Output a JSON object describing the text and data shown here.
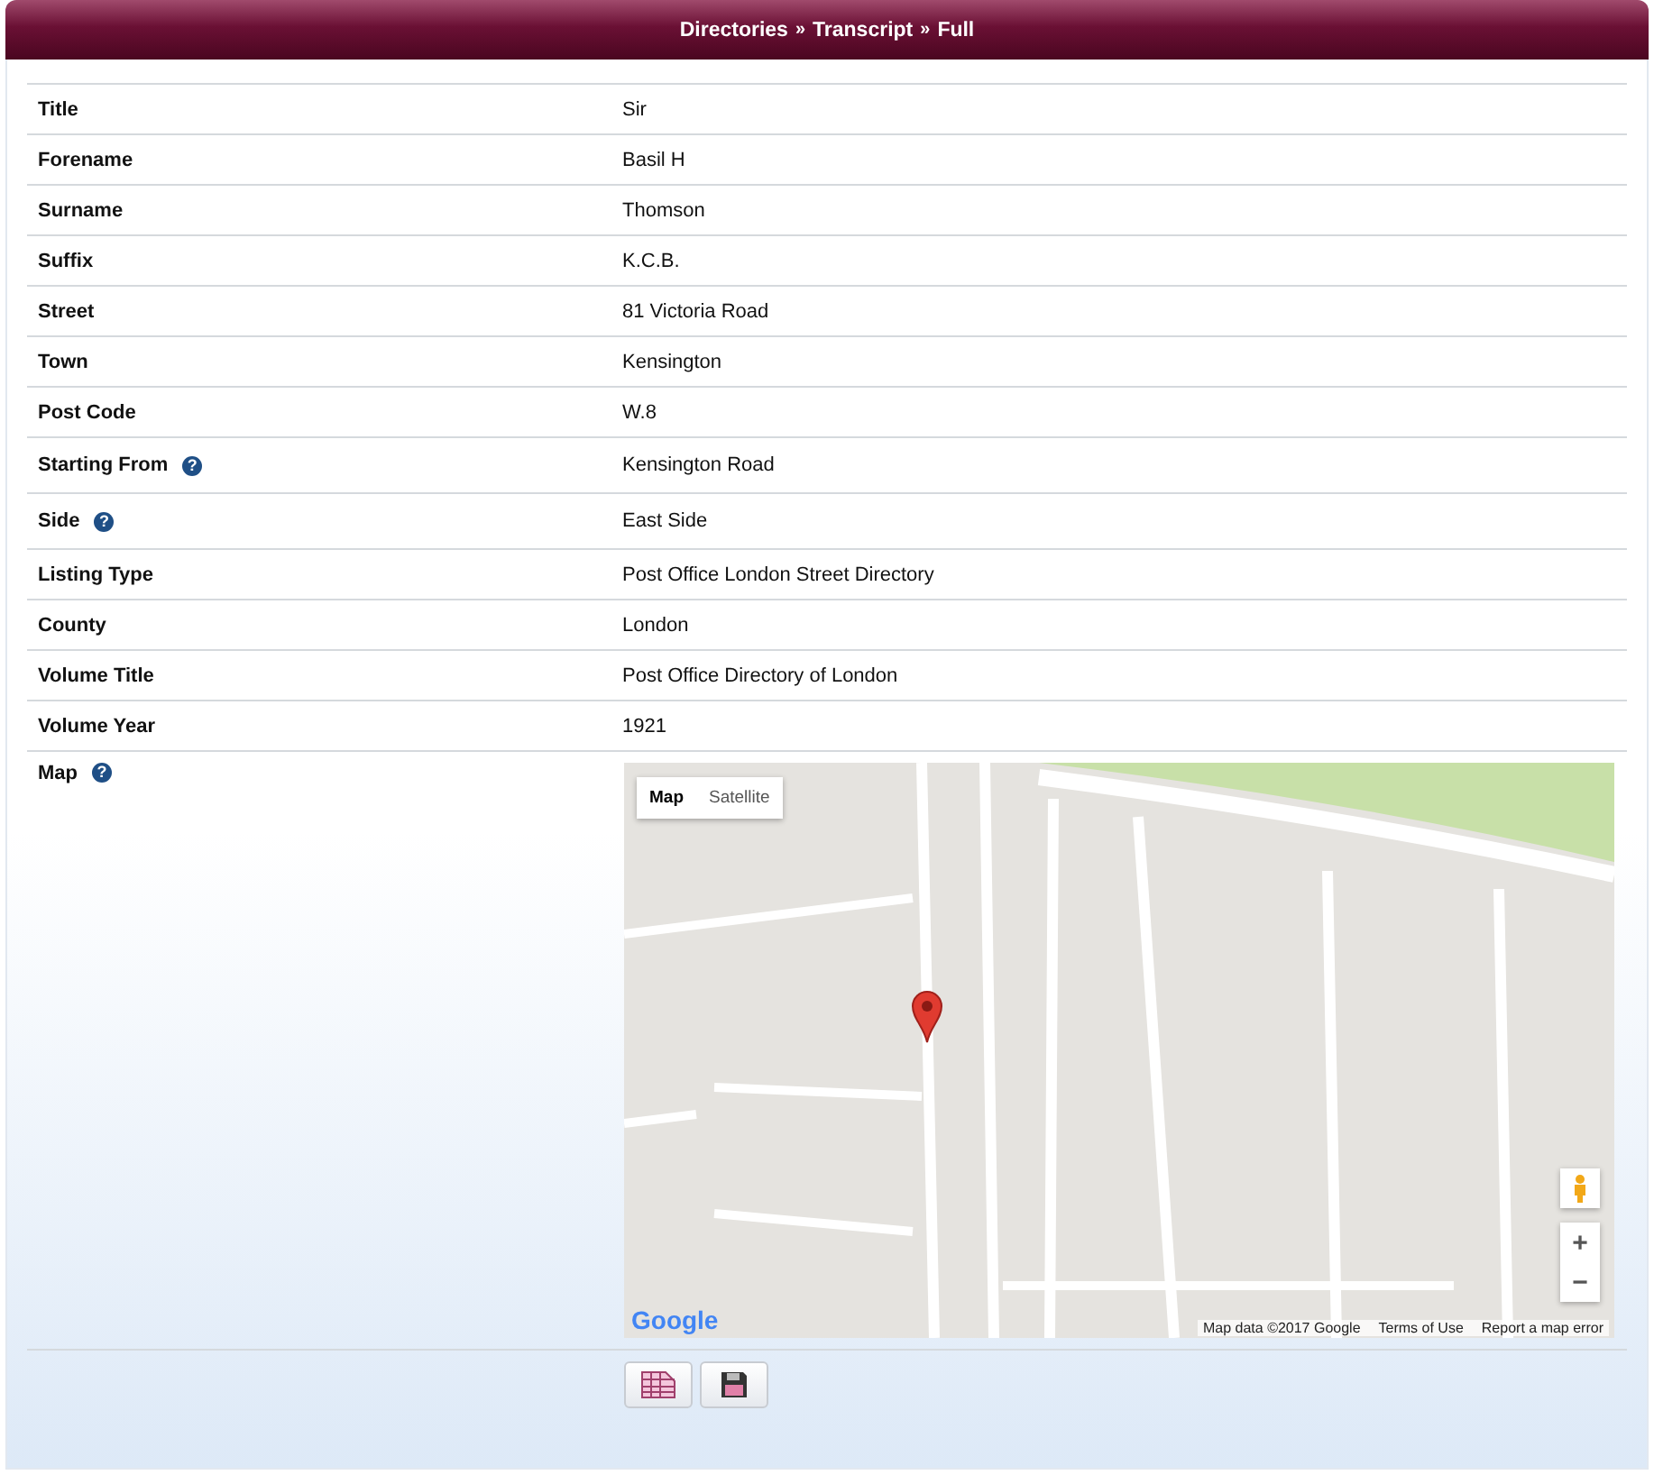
{
  "header": {
    "breadcrumb": [
      "Directories",
      "Transcript",
      "Full"
    ],
    "separator": "»"
  },
  "fields": [
    {
      "label": "Title",
      "value": "Sir"
    },
    {
      "label": "Forename",
      "value": "Basil H"
    },
    {
      "label": "Surname",
      "value": "Thomson"
    },
    {
      "label": "Suffix",
      "value": "K.C.B."
    },
    {
      "label": "Street",
      "value": "81 Victoria Road"
    },
    {
      "label": "Town",
      "value": "Kensington"
    },
    {
      "label": "Post Code",
      "value": "W.8"
    },
    {
      "label": "Starting From",
      "value": "Kensington Road",
      "help": "?"
    },
    {
      "label": "Side",
      "value": "East Side",
      "help": "?"
    },
    {
      "label": "Listing Type",
      "value": "Post Office London Street Directory"
    },
    {
      "label": "County",
      "value": "London"
    },
    {
      "label": "Volume Title",
      "value": "Post Office Directory of London"
    },
    {
      "label": "Volume Year",
      "value": "1921"
    }
  ],
  "map": {
    "label": "Map",
    "help": "?",
    "map_type": [
      {
        "label": "Map",
        "selected": true
      },
      {
        "label": "Satellite",
        "selected": false
      }
    ],
    "zoom": [
      "+",
      "−"
    ],
    "logo": "Google",
    "attribution": [
      "Map data ©2017 Google",
      "Terms of Use",
      "Report a map error"
    ]
  },
  "buttons": [
    {
      "kind": "table"
    },
    {
      "kind": "save"
    }
  ]
}
